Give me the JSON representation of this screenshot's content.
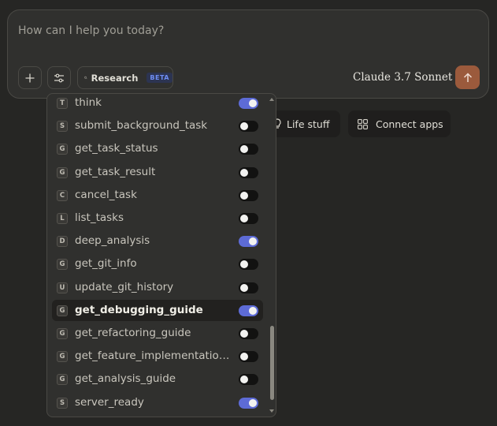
{
  "composer": {
    "placeholder": "How can I help you today?",
    "research_label": "Research",
    "beta_label": "BETA",
    "model_name": "Claude 3.7 Sonnet",
    "icons": {
      "add": "plus-icon",
      "tools": "sliders-icon",
      "research": "search-icon",
      "model": "chevron-down-icon",
      "send": "arrow-up-icon"
    },
    "colors": {
      "send": "#9b5a3c",
      "beta": "#6f8ff5"
    }
  },
  "chips": {
    "life_stuff": "Life stuff",
    "connect_apps": "Connect apps"
  },
  "tools": {
    "toggle_on_color": "#5d6bd6",
    "items": [
      {
        "letter": "T",
        "name": "think",
        "enabled": true
      },
      {
        "letter": "S",
        "name": "submit_background_task",
        "enabled": false
      },
      {
        "letter": "G",
        "name": "get_task_status",
        "enabled": false
      },
      {
        "letter": "G",
        "name": "get_task_result",
        "enabled": false
      },
      {
        "letter": "C",
        "name": "cancel_task",
        "enabled": false
      },
      {
        "letter": "L",
        "name": "list_tasks",
        "enabled": false
      },
      {
        "letter": "D",
        "name": "deep_analysis",
        "enabled": true
      },
      {
        "letter": "G",
        "name": "get_git_info",
        "enabled": false
      },
      {
        "letter": "U",
        "name": "update_git_history",
        "enabled": false
      },
      {
        "letter": "G",
        "name": "get_debugging_guide",
        "enabled": true,
        "highlighted": true
      },
      {
        "letter": "G",
        "name": "get_refactoring_guide",
        "enabled": false
      },
      {
        "letter": "G",
        "name": "get_feature_implementation...",
        "enabled": false
      },
      {
        "letter": "G",
        "name": "get_analysis_guide",
        "enabled": false
      },
      {
        "letter": "S",
        "name": "server_ready",
        "enabled": true
      }
    ]
  }
}
